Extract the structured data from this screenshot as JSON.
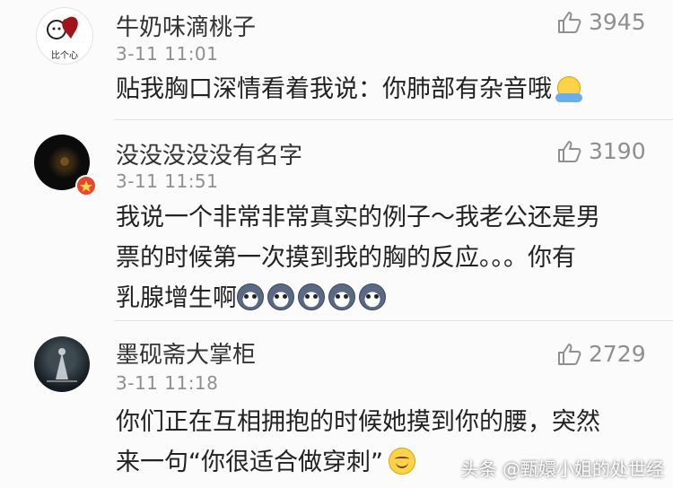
{
  "comments": [
    {
      "username": "牛奶味滴桃子",
      "avatar_caption": "比个心",
      "timestamp": "3-11 11:01",
      "likes": "3945",
      "lines": [
        "贴我胸口深情看着我说：你肺部有杂音哦"
      ]
    },
    {
      "username": "没没没没没有名字",
      "timestamp": "3-11 11:51",
      "likes": "3190",
      "lines": [
        "我说一个非常非常真实的例子～我老公还是男",
        "票的时候第一次摸到我的胸的反应。。。你有",
        "乳腺增生啊"
      ]
    },
    {
      "username": "墨砚斋大掌柜",
      "timestamp": "3-11 11:18",
      "likes": "2729",
      "lines": [
        "你们正在互相拥抱的时候她摸到你的腰，突然",
        "来一句“你很适合做穿刺”"
      ]
    }
  ],
  "icons": {
    "like": "thumbs-up-icon",
    "badge": "verified-badge-icon",
    "emoji_bath": "bathing-emoji",
    "emoji_husky": "husky-face-emoji",
    "emoji_smile": "grinning-face-emoji"
  },
  "watermark": "头条 @甄嬛小姐的处世经",
  "colors": {
    "text": "#222222",
    "meta": "#8f8f8f",
    "background": "#fbfbfb",
    "divider": "#e1e1e1"
  }
}
